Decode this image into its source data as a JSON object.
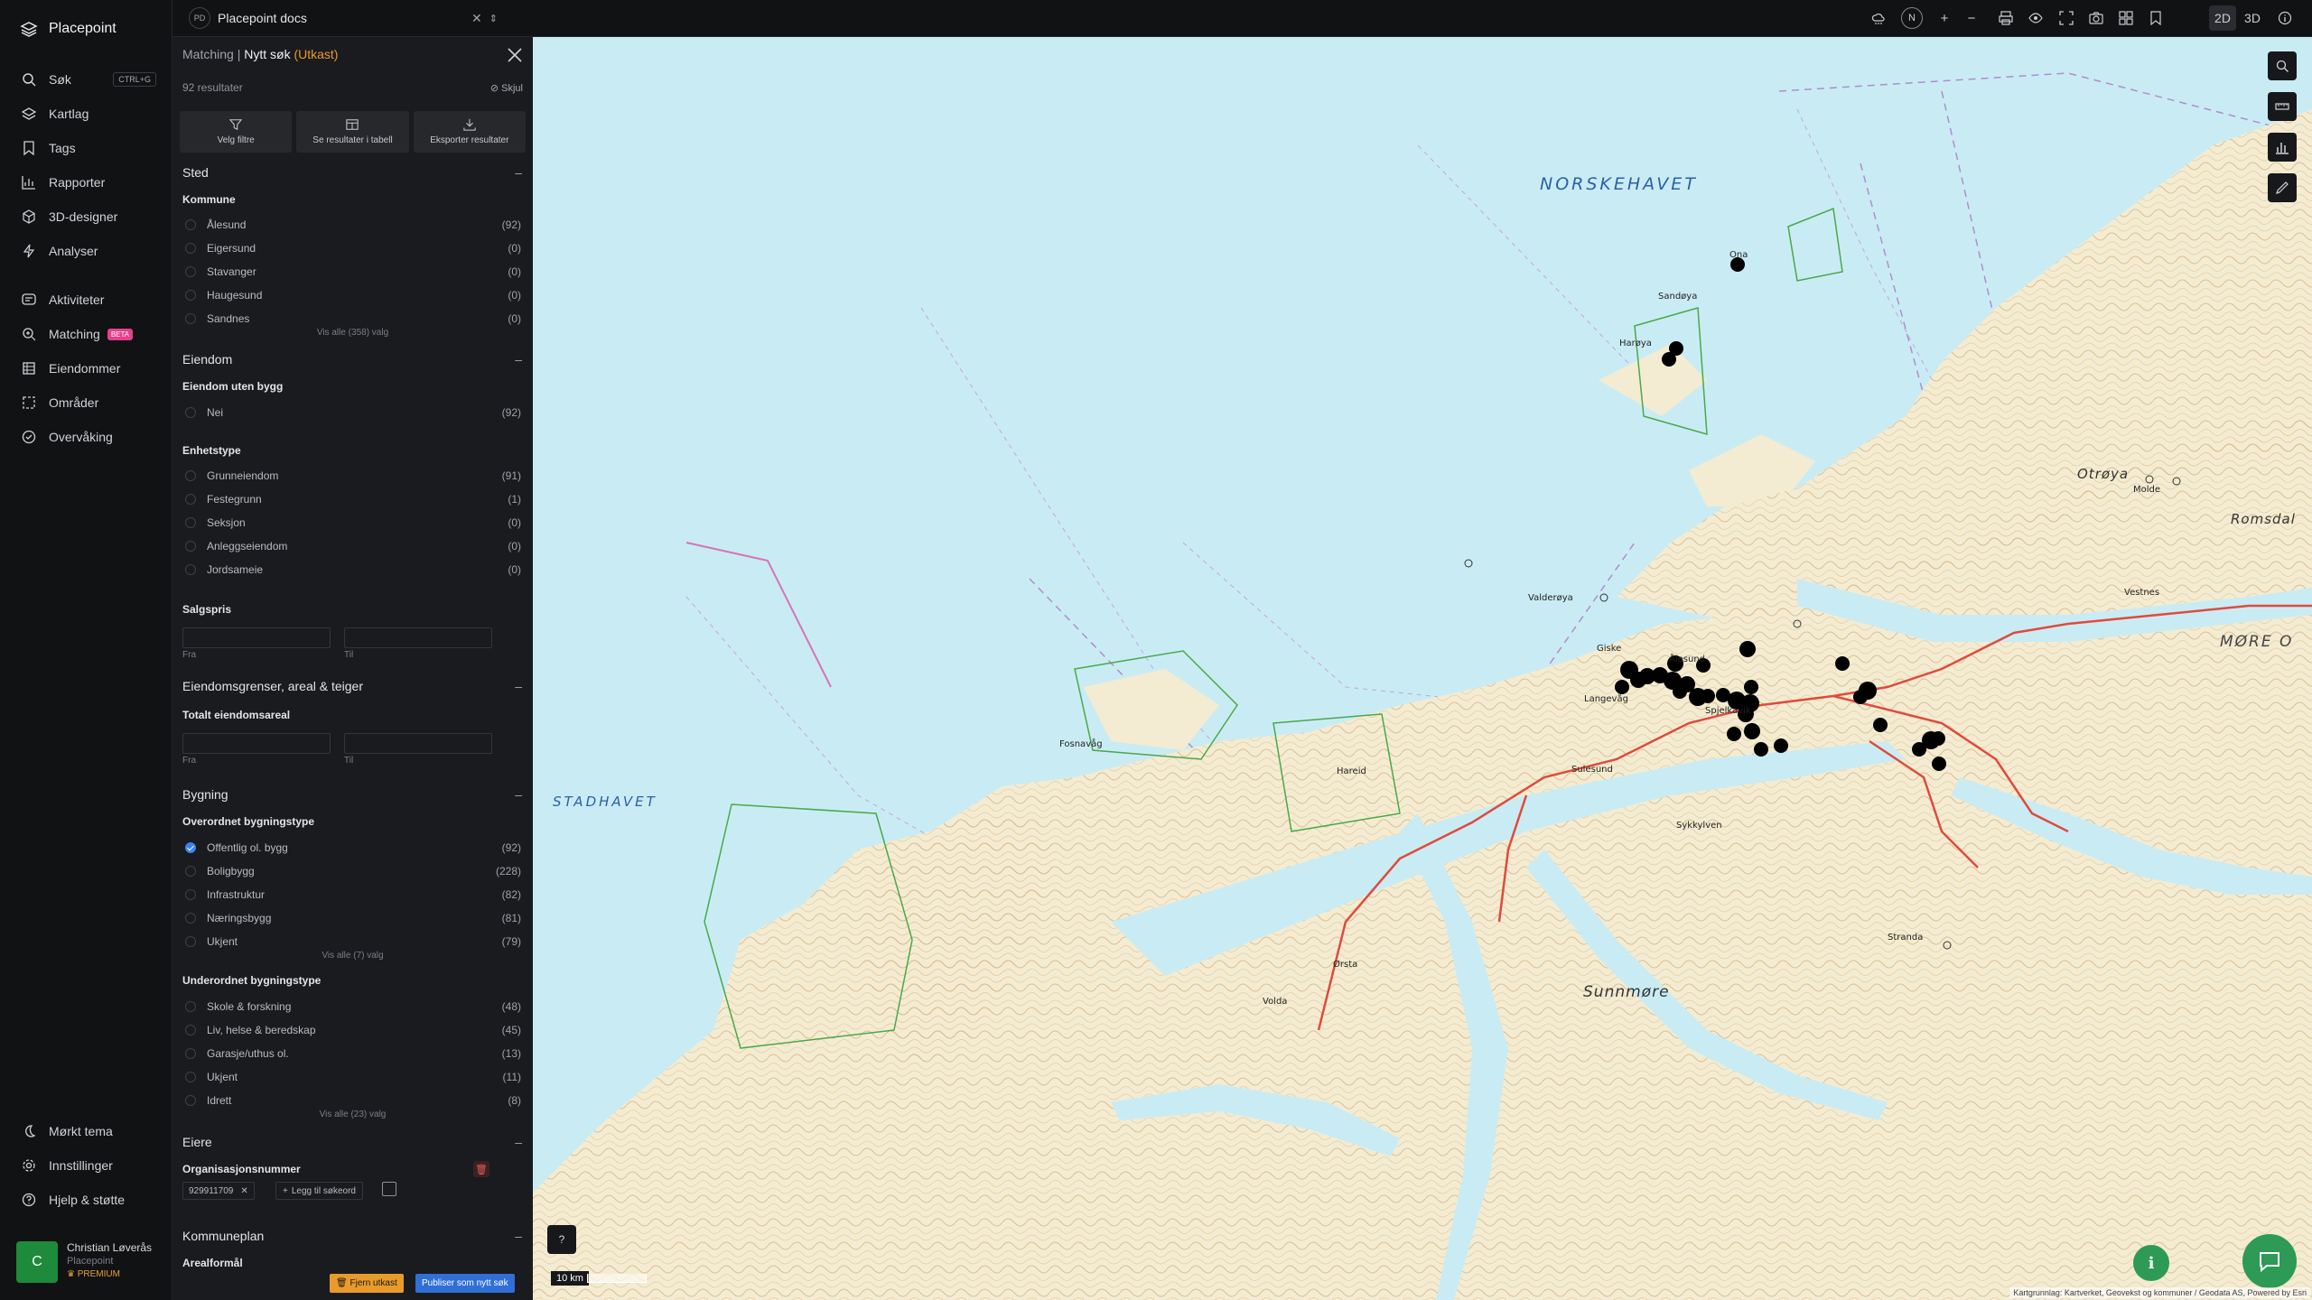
{
  "app": {
    "name": "Placepoint"
  },
  "nav": [
    {
      "label": "Søk",
      "icon": "search-icon",
      "shortcut": "CTRL+G"
    },
    {
      "label": "Kartlag",
      "icon": "layers-icon"
    },
    {
      "label": "Tags",
      "icon": "bookmark-icon"
    },
    {
      "label": "Rapporter",
      "icon": "chart-icon"
    },
    {
      "label": "3D-designer",
      "icon": "cube-icon"
    },
    {
      "label": "Analyser",
      "icon": "bolt-icon"
    },
    {
      "label": "Aktiviteter",
      "icon": "activity-icon"
    },
    {
      "label": "Matching",
      "icon": "matching-icon",
      "badge": "BETA"
    },
    {
      "label": "Eiendommer",
      "icon": "building-icon"
    },
    {
      "label": "Områder",
      "icon": "area-icon"
    },
    {
      "label": "Overvåking",
      "icon": "monitor-icon"
    }
  ],
  "nav_bottom": [
    {
      "label": "Mørkt tema",
      "icon": "moon-icon"
    },
    {
      "label": "Innstillinger",
      "icon": "gear-icon"
    },
    {
      "label": "Hjelp & støtte",
      "icon": "help-icon"
    }
  ],
  "user": {
    "initial": "C",
    "name": "Christian Løverås",
    "org": "Placepoint",
    "tier": "PREMIUM"
  },
  "workspace": {
    "badge": "PD",
    "name": "Placepoint docs"
  },
  "topbar": {
    "north": "N",
    "mode_2d": "2D",
    "mode_3d": "3D"
  },
  "panel": {
    "crumb": "Matching",
    "sep": "|",
    "title": "Nytt søk",
    "draft": "(Utkast)",
    "results": "92 resultater",
    "hide": "Skjul",
    "actions": [
      "Velg filtre",
      "Se resultater i tabell",
      "Eksporter resultater"
    ],
    "sted": {
      "title": "Sted",
      "kommune_label": "Kommune",
      "kommune": [
        {
          "name": "Ålesund",
          "count": "(92)"
        },
        {
          "name": "Eigersund",
          "count": "(0)"
        },
        {
          "name": "Stavanger",
          "count": "(0)"
        },
        {
          "name": "Haugesund",
          "count": "(0)"
        },
        {
          "name": "Sandnes",
          "count": "(0)"
        }
      ],
      "show_all": "Vis alle (358) valg"
    },
    "eiendom": {
      "title": "Eiendom",
      "uten_bygg_label": "Eiendom uten bygg",
      "uten_bygg": [
        {
          "name": "Nei",
          "count": "(92)"
        }
      ],
      "enhetstype_label": "Enhetstype",
      "enhetstype": [
        {
          "name": "Grunneiendom",
          "count": "(91)"
        },
        {
          "name": "Festegrunn",
          "count": "(1)"
        },
        {
          "name": "Seksjon",
          "count": "(0)"
        },
        {
          "name": "Anleggseiendom",
          "count": "(0)"
        },
        {
          "name": "Jordsameie",
          "count": "(0)"
        }
      ],
      "salgspris_label": "Salgspris",
      "from": "Fra",
      "to": "Til",
      "from_ph": "--",
      "to_ph": "--"
    },
    "grenser": {
      "title": "Eiendomsgrenser, areal & teiger",
      "areal_label": "Totalt eiendomsareal",
      "from": "Fra",
      "to": "Til"
    },
    "bygning": {
      "title": "Bygning",
      "overordnet_label": "Overordnet bygningstype",
      "overordnet": [
        {
          "name": "Offentlig ol. bygg",
          "count": "(92)",
          "checked": true
        },
        {
          "name": "Boligbygg",
          "count": "(228)"
        },
        {
          "name": "Infrastruktur",
          "count": "(82)"
        },
        {
          "name": "Næringsbygg",
          "count": "(81)"
        },
        {
          "name": "Ukjent",
          "count": "(79)"
        }
      ],
      "overordnet_show_all": "Vis alle (7) valg",
      "underordnet_label": "Underordnet bygningstype",
      "underordnet": [
        {
          "name": "Skole & forskning",
          "count": "(48)"
        },
        {
          "name": "Liv, helse & beredskap",
          "count": "(45)"
        },
        {
          "name": "Garasje/uthus ol.",
          "count": "(13)"
        },
        {
          "name": "Ukjent",
          "count": "(11)"
        },
        {
          "name": "Idrett",
          "count": "(8)"
        }
      ],
      "underordnet_show_all": "Vis alle (23) valg"
    },
    "eiere": {
      "title": "Eiere",
      "org_label": "Organisasjonsnummer",
      "org_chip": "929911709",
      "add_keyword": "Legg til søkeord"
    },
    "kommuneplan": {
      "title": "Kommuneplan",
      "areal_label": "Arealformål"
    },
    "remove_draft": "Fjern utkast",
    "publish": "Publiser som nytt søk",
    "collapse": "–"
  },
  "map": {
    "labels": {
      "norskehavet": "NORSKEHAVET",
      "stadhavet": "STADHAVET",
      "sunnmore": "Sunnmøre",
      "otroya": "Otrøya",
      "romsdal": "Romsdal",
      "more": "MØRE O",
      "alesund": "Ålesund",
      "ona": "Ona",
      "harøya": "Harøya",
      "sandøya": "Sandøya",
      "giske": "Giske",
      "valderøya": "Valderøya",
      "langevag": "Langevåg",
      "spjelkavik": "Spjelkavik",
      "sykkylven": "Sykkylven",
      "stranda": "Stranda",
      "molde": "Molde",
      "vestnes": "Vestnes",
      "sulesund": "Sulesund",
      "fosnavag": "Fosnavåg",
      "hareid": "Hareid",
      "orsta": "Ørsta",
      "volda": "Volda"
    },
    "scale": "10 km",
    "help": "?",
    "info": "i",
    "attribution": "Kartgrunnlag: Kartverket, Geovekst og kommuner / Geodata AS, Powered by Esri"
  },
  "colors": {
    "accent": "#3b82f6",
    "draft": "#e89b2b",
    "beta": "#e83e8c",
    "publish": "#2f6fd6",
    "sea": "#c9ecf4",
    "land": "#f3ecd2",
    "marker": "#000000"
  }
}
